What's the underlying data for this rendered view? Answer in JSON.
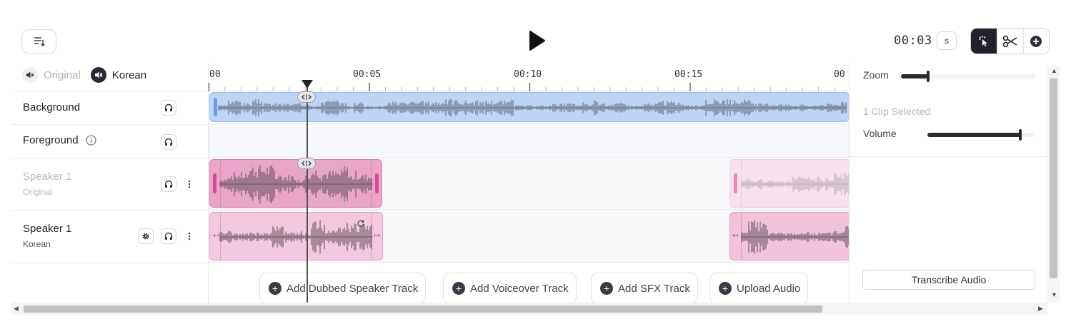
{
  "toolbar": {
    "list_icon": "list-download-icon",
    "play_icon": "play-icon",
    "timecode": "00:03",
    "unit_label": "s",
    "tools": [
      {
        "name": "select-tool",
        "icon": "pointer-click-icon",
        "active": true
      },
      {
        "name": "cut-tool",
        "icon": "scissors-icon",
        "active": false
      },
      {
        "name": "add-tool",
        "icon": "plus-circle-icon",
        "active": false
      }
    ]
  },
  "language_toggle": {
    "original_label": "Original",
    "korean_label": "Korean",
    "original_icon": "speaker-muted-icon",
    "korean_icon": "speaker-on-icon"
  },
  "tracks": [
    {
      "id": "background",
      "name": "Background",
      "sub": ""
    },
    {
      "id": "foreground",
      "name": "Foreground",
      "sub": "",
      "info_icon": "info-icon"
    },
    {
      "id": "speaker1-original",
      "name": "Speaker 1",
      "sub": "Original"
    },
    {
      "id": "speaker1-korean",
      "name": "Speaker 1",
      "sub": "Korean"
    }
  ],
  "ruler": {
    "labels": [
      "00",
      "00:05",
      "00:10",
      "00:15",
      "00"
    ]
  },
  "add_buttons": [
    {
      "label": "Add Dubbed Speaker Track"
    },
    {
      "label": "Add Voiceover Track"
    },
    {
      "label": "Add SFX Track"
    },
    {
      "label": "Upload Audio"
    }
  ],
  "right_panel": {
    "zoom_label": "Zoom",
    "zoom_level": 0.2,
    "clip_selected": "1 Clip Selected",
    "volume_label": "Volume",
    "volume_level": 0.86,
    "transcribe_label": "Transcribe Audio"
  },
  "colors": {
    "background_clip": "#bcd4f5",
    "speaker_clip": "#e9a6c8",
    "accent_dark": "#22222c"
  }
}
